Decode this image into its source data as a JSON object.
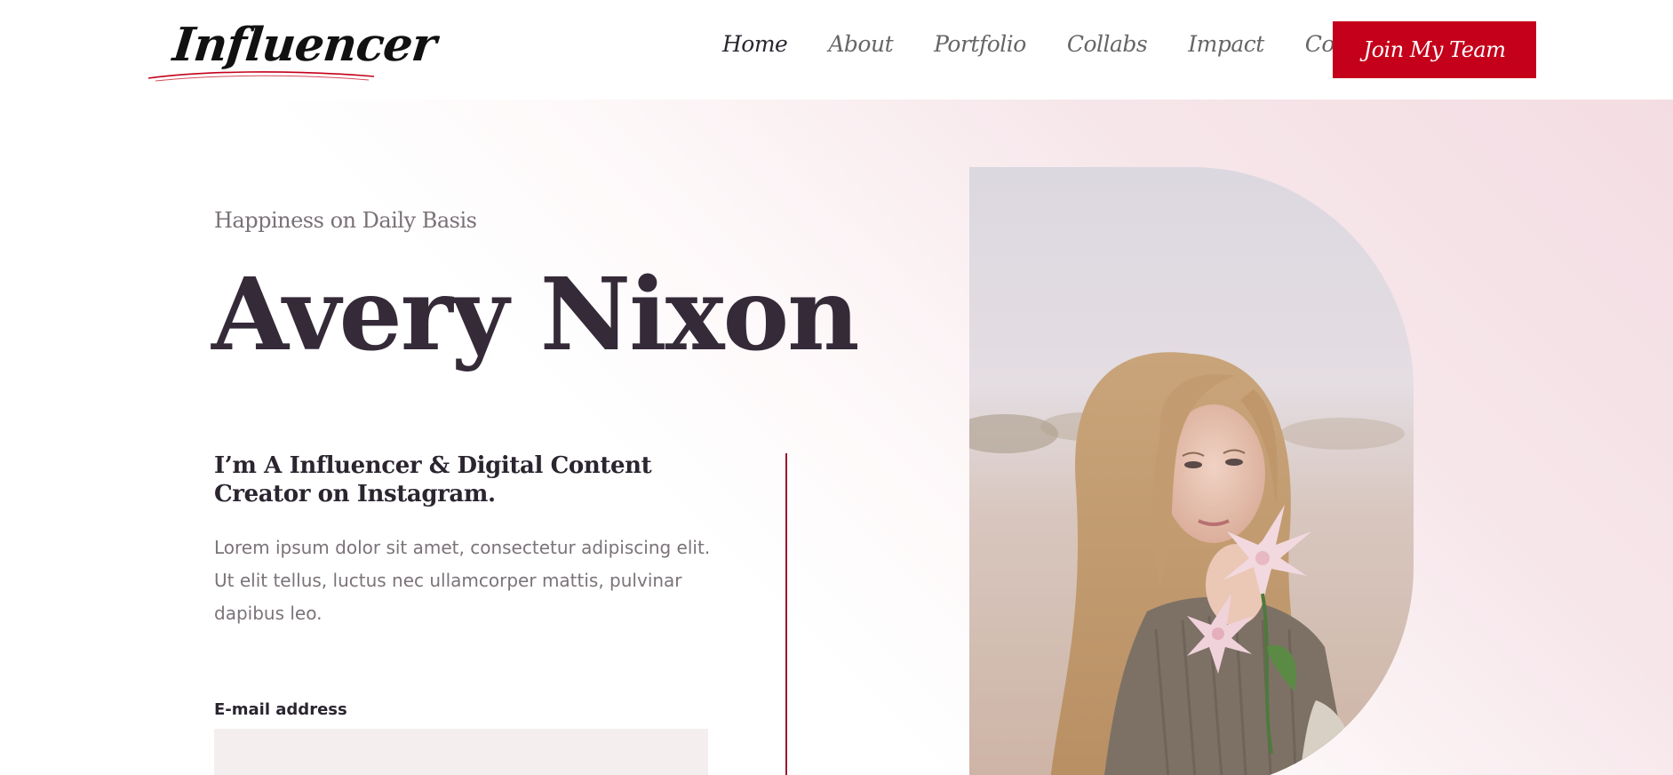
{
  "header": {
    "logo_text": "Influencer",
    "nav": [
      {
        "label": "Home",
        "active": true
      },
      {
        "label": "About",
        "active": false
      },
      {
        "label": "Portfolio",
        "active": false
      },
      {
        "label": "Collabs",
        "active": false
      },
      {
        "label": "Impact",
        "active": false
      },
      {
        "label": "Contact",
        "active": false
      }
    ],
    "cta_label": "Join My Team"
  },
  "hero": {
    "tagline": "Happiness on Daily Basis",
    "name": "Avery Nixon",
    "subhead": "I’m A Influencer & Digital Content Creator on Instagram.",
    "body": "Lorem ipsum dolor sit amet, consectetur adipiscing elit. Ut elit tellus, luctus nec ullamcorper mattis, pulvinar dapibus leo.",
    "email_label": "E-mail address",
    "email_value": "",
    "photo_icon": "portrait-photo"
  },
  "colors": {
    "accent": "#c4001a",
    "heading": "#352a38",
    "muted": "#7b7379",
    "hero_tint": "#f3dde3",
    "divider": "#9a1630"
  }
}
